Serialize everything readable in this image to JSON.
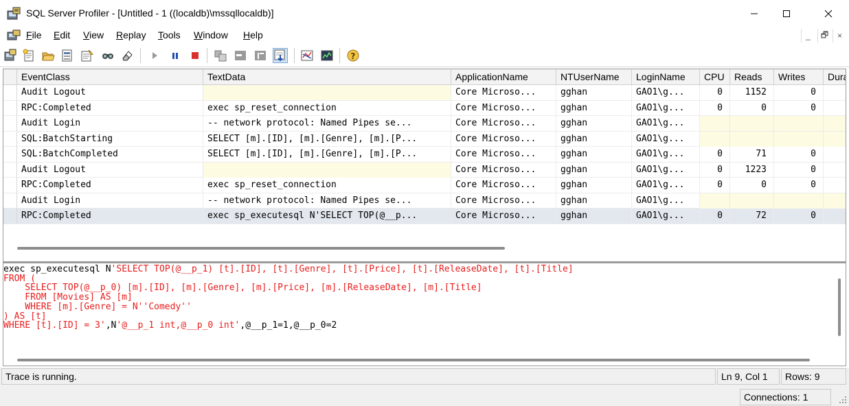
{
  "window": {
    "title": "SQL Server Profiler - [Untitled - 1 ((localdb)\\mssqllocaldb)]",
    "minimize_glyph": "—",
    "maximize_glyph": "☐",
    "close_glyph": "✕"
  },
  "menu": [
    {
      "label": "File",
      "accel": "F",
      "rest": "ile"
    },
    {
      "label": "Edit",
      "accel": "E",
      "rest": "dit"
    },
    {
      "label": "View",
      "accel": "V",
      "rest": "iew"
    },
    {
      "label": "Replay",
      "accel": "R",
      "rest": "eplay"
    },
    {
      "label": "Tools",
      "accel": "T",
      "rest": "ools"
    },
    {
      "label": "Window",
      "accel": "W",
      "rest": "indow"
    },
    {
      "label": "Help",
      "accel": "H",
      "rest": "elp"
    }
  ],
  "mdi_controls": {
    "minimize": "_",
    "restore": "🗗",
    "close": "×"
  },
  "toolbar": {
    "icons": [
      "new-trace-icon",
      "new-template-icon",
      "open-icon",
      "properties-icon",
      "template-properties-icon",
      "find-icon",
      "clear-trace-icon",
      "start-icon",
      "pause-icon",
      "stop-icon",
      "replay-step-icon",
      "replay-cursor-icon",
      "replay-run-icon",
      "auto-scroll-icon",
      "activity-monitor-icon",
      "performance-monitor-icon",
      "help-icon"
    ]
  },
  "grid": {
    "columns": [
      "EventClass",
      "TextData",
      "ApplicationName",
      "NTUserName",
      "LoginName",
      "CPU",
      "Reads",
      "Writes",
      "Dura"
    ],
    "rows": [
      {
        "event": "Audit Logout",
        "text": "",
        "app": "Core Microso...",
        "nt": "gghan",
        "login": "GAO1\\g...",
        "cpu": "0",
        "reads": "1152",
        "writes": "0",
        "blank_perf": false
      },
      {
        "event": "RPC:Completed",
        "text": "exec sp_reset_connection",
        "app": "Core Microso...",
        "nt": "gghan",
        "login": "GAO1\\g...",
        "cpu": "0",
        "reads": "0",
        "writes": "0",
        "blank_perf": false
      },
      {
        "event": "Audit Login",
        "text": "-- network protocol: Named Pipes  se...",
        "app": "Core Microso...",
        "nt": "gghan",
        "login": "GAO1\\g...",
        "cpu": "",
        "reads": "",
        "writes": "",
        "blank_perf": true
      },
      {
        "event": "SQL:BatchStarting",
        "text": "SELECT [m].[ID], [m].[Genre], [m].[P...",
        "app": "Core Microso...",
        "nt": "gghan",
        "login": "GAO1\\g...",
        "cpu": "",
        "reads": "",
        "writes": "",
        "blank_perf": true
      },
      {
        "event": "SQL:BatchCompleted",
        "text": "SELECT [m].[ID], [m].[Genre], [m].[P...",
        "app": "Core Microso...",
        "nt": "gghan",
        "login": "GAO1\\g...",
        "cpu": "0",
        "reads": "71",
        "writes": "0",
        "blank_perf": false
      },
      {
        "event": "Audit Logout",
        "text": "",
        "app": "Core Microso...",
        "nt": "gghan",
        "login": "GAO1\\g...",
        "cpu": "0",
        "reads": "1223",
        "writes": "0",
        "blank_perf": false
      },
      {
        "event": "RPC:Completed",
        "text": "exec sp_reset_connection",
        "app": "Core Microso...",
        "nt": "gghan",
        "login": "GAO1\\g...",
        "cpu": "0",
        "reads": "0",
        "writes": "0",
        "blank_perf": false
      },
      {
        "event": "Audit Login",
        "text": "-- network protocol: Named Pipes  se...",
        "app": "Core Microso...",
        "nt": "gghan",
        "login": "GAO1\\g...",
        "cpu": "",
        "reads": "",
        "writes": "",
        "blank_perf": true
      },
      {
        "event": "RPC:Completed",
        "text": "exec sp_executesql N'SELECT TOP(@__p...",
        "app": "Core Microso...",
        "nt": "gghan",
        "login": "GAO1\\g...",
        "cpu": "0",
        "reads": "72",
        "writes": "0",
        "blank_perf": false,
        "selected": true
      }
    ]
  },
  "detail": {
    "lines": [
      [
        {
          "t": "exec sp_executesql N",
          "c": "k"
        },
        {
          "t": "'SELECT TOP(@__p_1) [t].[ID], [t].[Genre], [t].[Price], [t].[ReleaseDate], [t].[Title]",
          "c": "r"
        }
      ],
      [
        {
          "t": "FROM (",
          "c": "r"
        }
      ],
      [
        {
          "t": "    SELECT TOP(@__p_0) [m].[ID], [m].[Genre], [m].[Price], [m].[ReleaseDate], [m].[Title]",
          "c": "r"
        }
      ],
      [
        {
          "t": "    FROM [Movies] AS [m]",
          "c": "r"
        }
      ],
      [
        {
          "t": "    WHERE [m].[Genre] = N''Comedy''",
          "c": "r"
        }
      ],
      [
        {
          "t": ") AS [t]",
          "c": "r"
        }
      ],
      [
        {
          "t": "WHERE [t].[ID] = 3'",
          "c": "r"
        },
        {
          "t": ",N",
          "c": "k"
        },
        {
          "t": "'@__p_1 int,@__p_0 int'",
          "c": "r"
        },
        {
          "t": ",@__p_1=1,@__p_0=2",
          "c": "k"
        }
      ]
    ]
  },
  "status": {
    "message": "Trace is running.",
    "position": "Ln 9, Col 1",
    "rows": "Rows: 9",
    "connections": "Connections: 1"
  }
}
